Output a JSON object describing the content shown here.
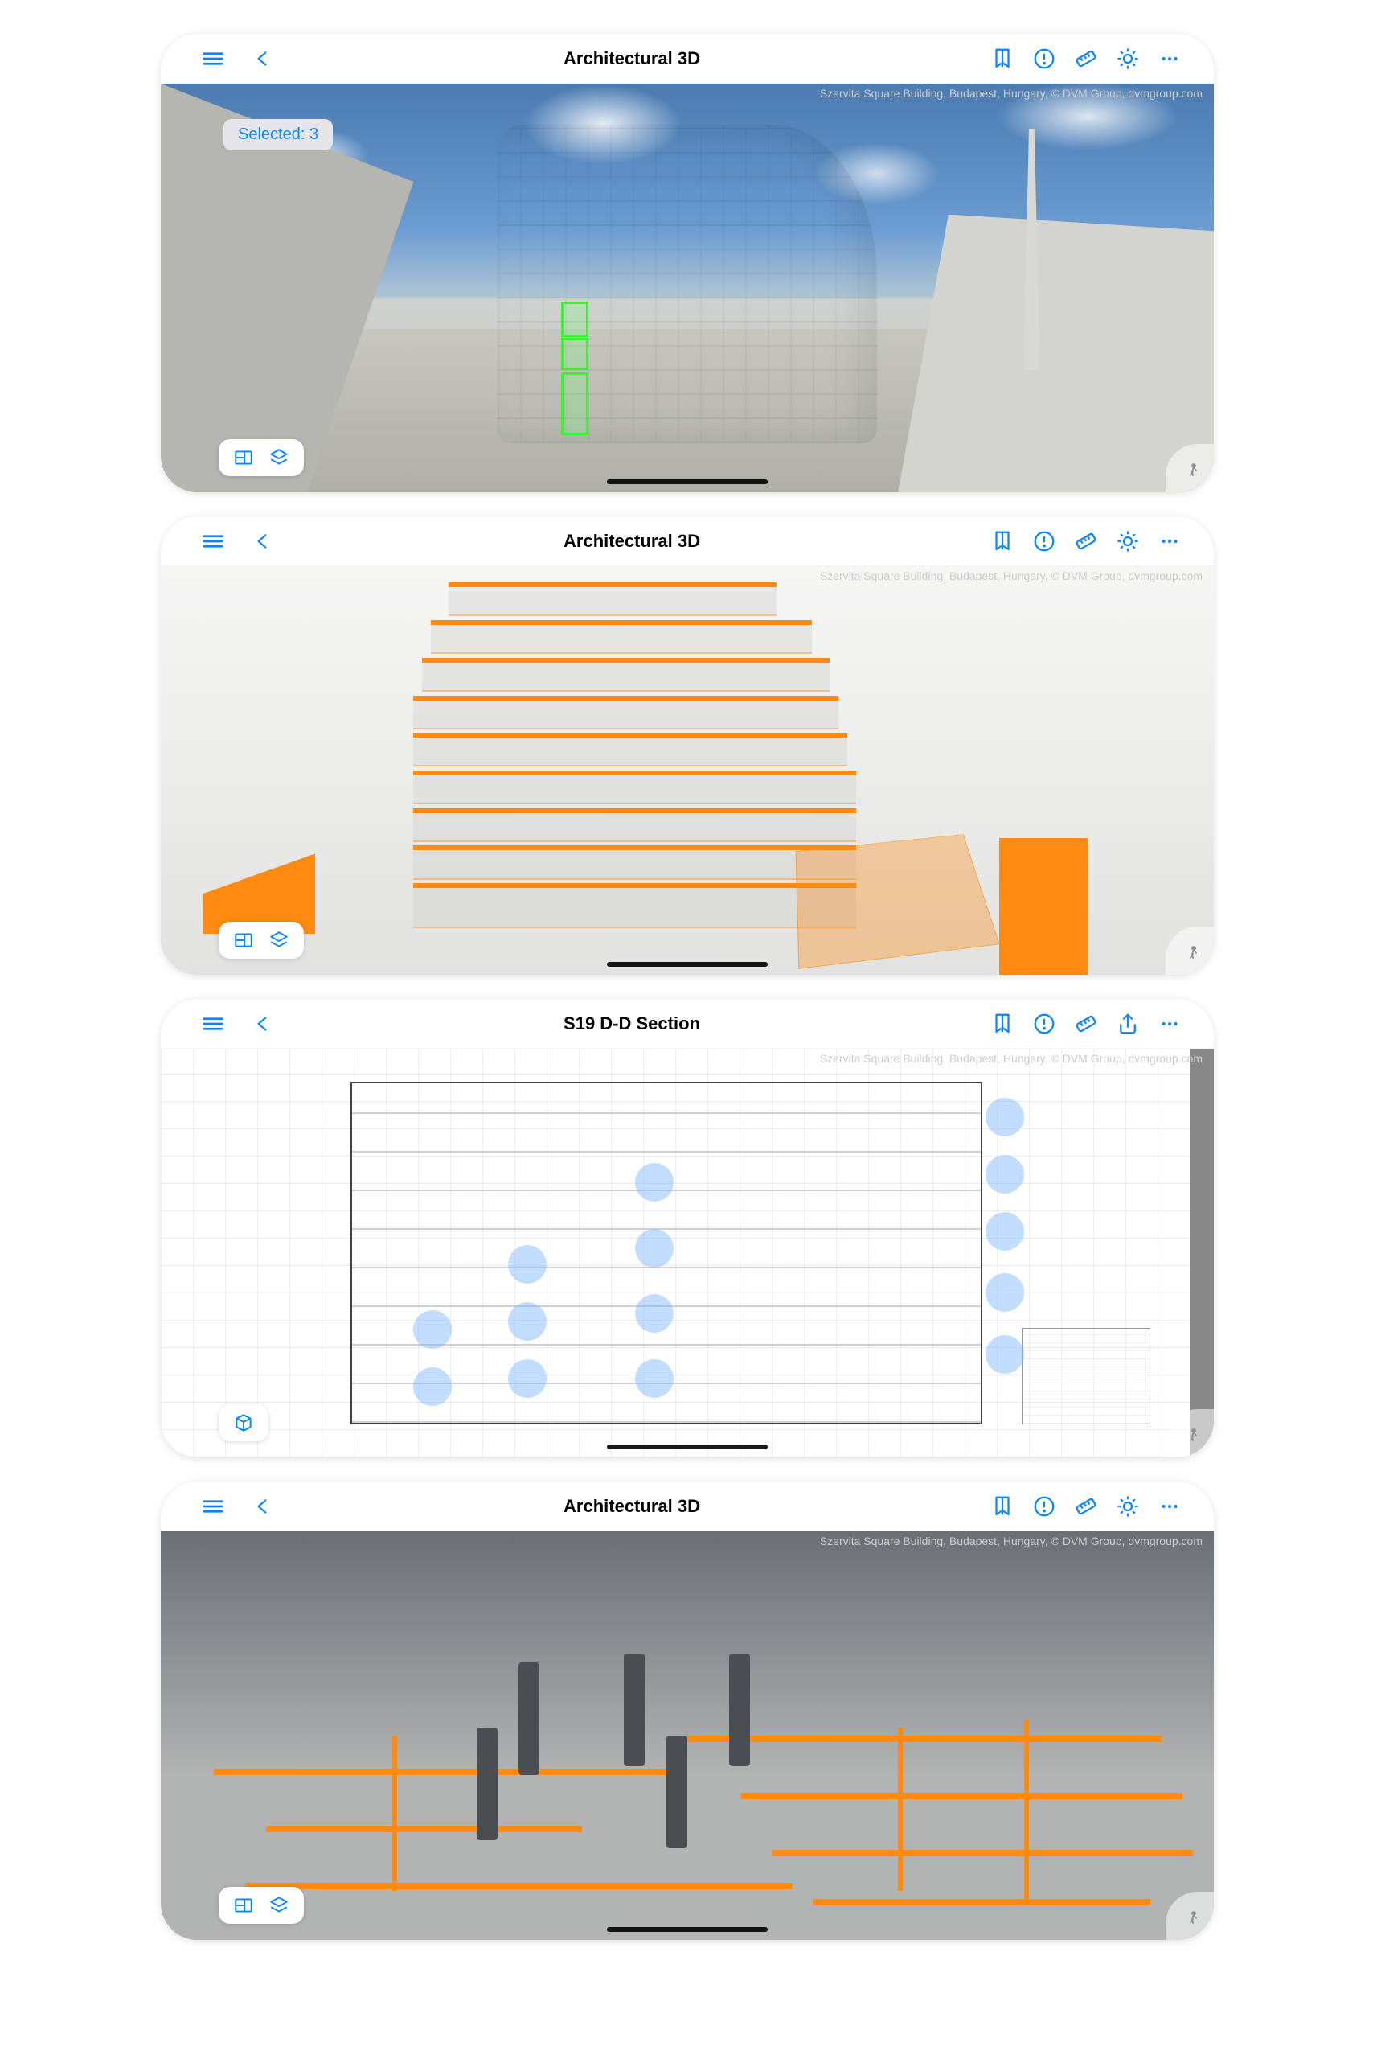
{
  "colors": {
    "accent": "#0a84ff",
    "highlight_orange": "#ff8a12",
    "selection_green": "#3af23a"
  },
  "attribution": "Szervita Square Building, Budapest, Hungary, © DVM Group, dvmgroup.com",
  "screens": [
    {
      "title": "Architectural 3D",
      "selected_badge": "Selected: 3",
      "toolbar_right": [
        "bookmark",
        "issue",
        "measure",
        "settings",
        "more"
      ],
      "bottom_controls": [
        "floorplan",
        "layers"
      ],
      "walk": true
    },
    {
      "title": "Architectural 3D",
      "toolbar_right": [
        "bookmark",
        "issue",
        "measure",
        "settings",
        "more"
      ],
      "bottom_controls": [
        "floorplan",
        "layers"
      ],
      "walk": true
    },
    {
      "title": "S19 D-D Section",
      "toolbar_right": [
        "bookmark",
        "issue",
        "measure",
        "share",
        "more"
      ],
      "bottom_controls": [
        "cube"
      ],
      "walk": true
    },
    {
      "title": "Architectural 3D",
      "toolbar_right": [
        "bookmark",
        "issue",
        "measure",
        "settings",
        "more"
      ],
      "bottom_controls": [
        "floorplan",
        "layers"
      ],
      "walk": true
    }
  ]
}
